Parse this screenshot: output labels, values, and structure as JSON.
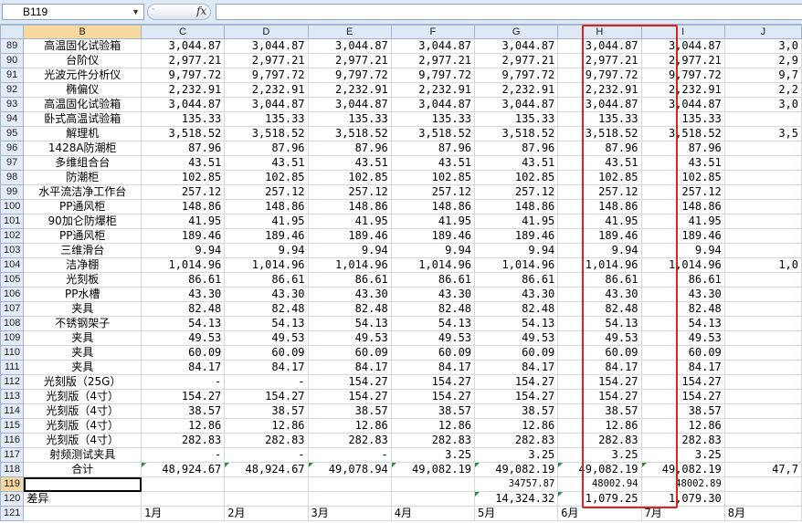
{
  "formula_bar": {
    "name_box": "B119",
    "fx_label": "fx",
    "formula": ""
  },
  "columns": [
    "B",
    "C",
    "D",
    "E",
    "F",
    "G",
    "H",
    "I",
    "J"
  ],
  "rows": [
    {
      "n": "89",
      "name": "高温固化试验箱",
      "v": [
        "3,044.87",
        "3,044.87",
        "3,044.87",
        "3,044.87",
        "3,044.87",
        "3,044.87",
        "3,044.87",
        "3,0"
      ]
    },
    {
      "n": "90",
      "name": "台阶仪",
      "v": [
        "2,977.21",
        "2,977.21",
        "2,977.21",
        "2,977.21",
        "2,977.21",
        "2,977.21",
        "2,977.21",
        "2,9"
      ]
    },
    {
      "n": "91",
      "name": "光波元件分析仪",
      "v": [
        "9,797.72",
        "9,797.72",
        "9,797.72",
        "9,797.72",
        "9,797.72",
        "9,797.72",
        "9,797.72",
        "9,7"
      ]
    },
    {
      "n": "92",
      "name": "椭偏仪",
      "v": [
        "2,232.91",
        "2,232.91",
        "2,232.91",
        "2,232.91",
        "2,232.91",
        "2,232.91",
        "2,232.91",
        "2,2"
      ]
    },
    {
      "n": "93",
      "name": "高温固化试验箱",
      "v": [
        "3,044.87",
        "3,044.87",
        "3,044.87",
        "3,044.87",
        "3,044.87",
        "3,044.87",
        "3,044.87",
        "3,0"
      ]
    },
    {
      "n": "94",
      "name": "卧式高温试验箱",
      "v": [
        "135.33",
        "135.33",
        "135.33",
        "135.33",
        "135.33",
        "135.33",
        "135.33",
        ""
      ]
    },
    {
      "n": "95",
      "name": "解理机",
      "v": [
        "3,518.52",
        "3,518.52",
        "3,518.52",
        "3,518.52",
        "3,518.52",
        "3,518.52",
        "3,518.52",
        "3,5"
      ]
    },
    {
      "n": "96",
      "name": "1428A防潮柜",
      "v": [
        "87.96",
        "87.96",
        "87.96",
        "87.96",
        "87.96",
        "87.96",
        "87.96",
        ""
      ]
    },
    {
      "n": "97",
      "name": "多维组合台",
      "v": [
        "43.51",
        "43.51",
        "43.51",
        "43.51",
        "43.51",
        "43.51",
        "43.51",
        ""
      ]
    },
    {
      "n": "98",
      "name": "防潮柜",
      "v": [
        "102.85",
        "102.85",
        "102.85",
        "102.85",
        "102.85",
        "102.85",
        "102.85",
        ""
      ]
    },
    {
      "n": "99",
      "name": "水平流洁净工作台",
      "v": [
        "257.12",
        "257.12",
        "257.12",
        "257.12",
        "257.12",
        "257.12",
        "257.12",
        ""
      ]
    },
    {
      "n": "100",
      "name": "PP通风柜",
      "v": [
        "148.86",
        "148.86",
        "148.86",
        "148.86",
        "148.86",
        "148.86",
        "148.86",
        ""
      ]
    },
    {
      "n": "101",
      "name": "90加仑防爆柜",
      "v": [
        "41.95",
        "41.95",
        "41.95",
        "41.95",
        "41.95",
        "41.95",
        "41.95",
        ""
      ]
    },
    {
      "n": "102",
      "name": "PP通风柜",
      "v": [
        "189.46",
        "189.46",
        "189.46",
        "189.46",
        "189.46",
        "189.46",
        "189.46",
        ""
      ]
    },
    {
      "n": "103",
      "name": "三维滑台",
      "v": [
        "9.94",
        "9.94",
        "9.94",
        "9.94",
        "9.94",
        "9.94",
        "9.94",
        ""
      ]
    },
    {
      "n": "104",
      "name": "洁净棚",
      "v": [
        "1,014.96",
        "1,014.96",
        "1,014.96",
        "1,014.96",
        "1,014.96",
        "1,014.96",
        "1,014.96",
        "1,0"
      ]
    },
    {
      "n": "105",
      "name": "光刻板",
      "v": [
        "86.61",
        "86.61",
        "86.61",
        "86.61",
        "86.61",
        "86.61",
        "86.61",
        ""
      ]
    },
    {
      "n": "106",
      "name": "PP水槽",
      "v": [
        "43.30",
        "43.30",
        "43.30",
        "43.30",
        "43.30",
        "43.30",
        "43.30",
        ""
      ]
    },
    {
      "n": "107",
      "name": "夹具",
      "v": [
        "82.48",
        "82.48",
        "82.48",
        "82.48",
        "82.48",
        "82.48",
        "82.48",
        ""
      ]
    },
    {
      "n": "108",
      "name": "不锈钢架子",
      "v": [
        "54.13",
        "54.13",
        "54.13",
        "54.13",
        "54.13",
        "54.13",
        "54.13",
        ""
      ]
    },
    {
      "n": "109",
      "name": "夹具",
      "v": [
        "49.53",
        "49.53",
        "49.53",
        "49.53",
        "49.53",
        "49.53",
        "49.53",
        ""
      ]
    },
    {
      "n": "110",
      "name": "夹具",
      "v": [
        "60.09",
        "60.09",
        "60.09",
        "60.09",
        "60.09",
        "60.09",
        "60.09",
        ""
      ]
    },
    {
      "n": "111",
      "name": "夹具",
      "v": [
        "84.17",
        "84.17",
        "84.17",
        "84.17",
        "84.17",
        "84.17",
        "84.17",
        ""
      ]
    },
    {
      "n": "112",
      "name": "光刻版（25G）",
      "v": [
        "-",
        "-",
        "154.27",
        "154.27",
        "154.27",
        "154.27",
        "154.27",
        ""
      ]
    },
    {
      "n": "113",
      "name": "光刻版（4寸）",
      "v": [
        "154.27",
        "154.27",
        "154.27",
        "154.27",
        "154.27",
        "154.27",
        "154.27",
        ""
      ]
    },
    {
      "n": "114",
      "name": "光刻版（4寸）",
      "v": [
        "38.57",
        "38.57",
        "38.57",
        "38.57",
        "38.57",
        "38.57",
        "38.57",
        ""
      ]
    },
    {
      "n": "115",
      "name": "光刻版（4寸）",
      "v": [
        "12.86",
        "12.86",
        "12.86",
        "12.86",
        "12.86",
        "12.86",
        "12.86",
        ""
      ]
    },
    {
      "n": "116",
      "name": "光刻版（4寸）",
      "v": [
        "282.83",
        "282.83",
        "282.83",
        "282.83",
        "282.83",
        "282.83",
        "282.83",
        ""
      ]
    },
    {
      "n": "117",
      "name": "射频测试夹具",
      "v": [
        "-",
        "-",
        "-",
        "3.25",
        "3.25",
        "3.25",
        "3.25",
        ""
      ]
    },
    {
      "n": "118",
      "name": "合计",
      "v": [
        "48,924.67",
        "48,924.67",
        "49,078.94",
        "49,082.19",
        "49,082.19",
        "49,082.19",
        "49,082.19",
        "47,7"
      ]
    },
    {
      "n": "119",
      "name": "",
      "v": [
        "",
        "",
        "",
        "",
        "34757.87",
        "48002.94",
        "48002.89",
        ""
      ]
    },
    {
      "n": "120",
      "name": "差异",
      "v": [
        "",
        "",
        "",
        "",
        "14,324.32",
        "1,079.25",
        "1,079.30",
        ""
      ]
    },
    {
      "n": "121",
      "name": "",
      "v": [
        "1月",
        "2月",
        "3月",
        "4月",
        "5月",
        "6月",
        "7月",
        "8月"
      ]
    }
  ]
}
